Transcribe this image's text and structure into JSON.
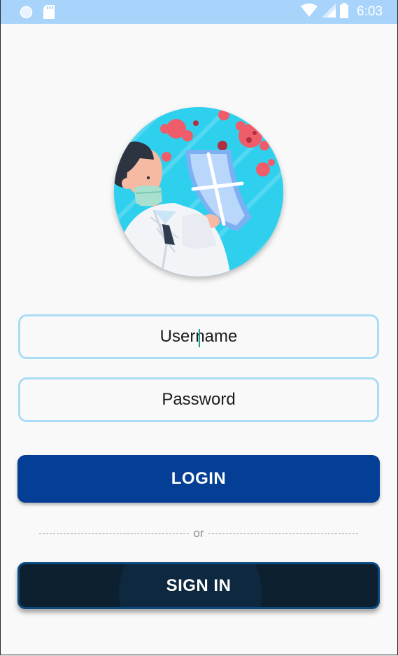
{
  "status_bar": {
    "time": "6:03",
    "bg_color": "#a8d4fb",
    "icons": [
      "circle-notification-icon",
      "sd-card-icon",
      "wifi-icon",
      "cell-signal-icon",
      "battery-icon"
    ]
  },
  "illustration": {
    "icon": "doctor-shield-virus-illustration",
    "bg_color": "#2fd0ee"
  },
  "form": {
    "username_placeholder": "Username",
    "password_placeholder": "Password"
  },
  "buttons": {
    "login_label": "LOGIN",
    "login_color": "#043f95",
    "signin_label": "SIGN IN",
    "signin_color": "#0d2030"
  },
  "divider": {
    "text": "or"
  }
}
